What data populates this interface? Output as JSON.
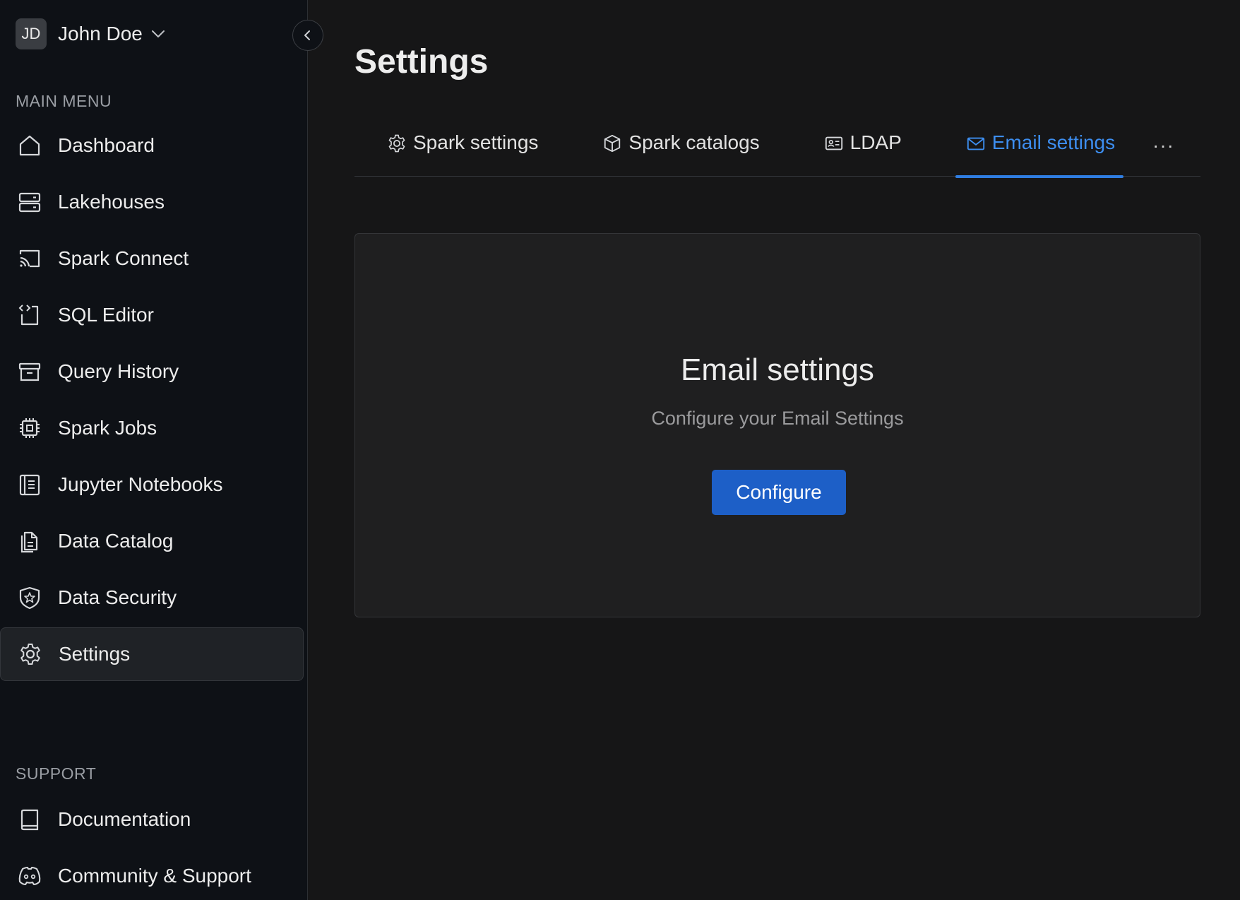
{
  "user": {
    "initials": "JD",
    "name": "John Doe"
  },
  "sidebar": {
    "main_menu_title": "MAIN MENU",
    "items": [
      {
        "label": "Dashboard",
        "icon": "home-icon"
      },
      {
        "label": "Lakehouses",
        "icon": "server-icon"
      },
      {
        "label": "Spark Connect",
        "icon": "cast-icon"
      },
      {
        "label": "SQL Editor",
        "icon": "code-editor-icon"
      },
      {
        "label": "Query History",
        "icon": "archive-icon"
      },
      {
        "label": "Spark Jobs",
        "icon": "cpu-chip-icon"
      },
      {
        "label": "Jupyter Notebooks",
        "icon": "notebook-icon"
      },
      {
        "label": "Data Catalog",
        "icon": "files-icon"
      },
      {
        "label": "Data Security",
        "icon": "shield-star-icon"
      },
      {
        "label": "Settings",
        "icon": "gear-icon",
        "active": true
      }
    ],
    "support_title": "SUPPORT",
    "support_items": [
      {
        "label": "Documentation",
        "icon": "book-icon"
      },
      {
        "label": "Community & Support",
        "icon": "discord-icon"
      }
    ]
  },
  "page": {
    "title": "Settings",
    "tabs": [
      {
        "label": "Spark settings",
        "icon": "gear-icon"
      },
      {
        "label": "Spark catalogs",
        "icon": "cube-icon"
      },
      {
        "label": "LDAP",
        "icon": "id-card-icon"
      },
      {
        "label": "Email settings",
        "icon": "mail-icon",
        "active": true
      }
    ],
    "more": "···"
  },
  "card": {
    "title": "Email settings",
    "subtitle": "Configure your Email Settings",
    "button": "Configure"
  },
  "colors": {
    "accent": "#2f7de1",
    "button": "#1d5fc7",
    "sidebar_bg": "#0e1116",
    "main_bg": "#161617"
  }
}
